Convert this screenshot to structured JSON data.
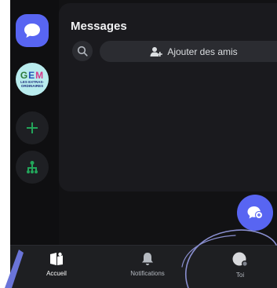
{
  "header": {
    "title": "Messages"
  },
  "search": {
    "icon": "search-icon"
  },
  "add_friends": {
    "label": "Ajouter des amis",
    "icon": "add-user-icon"
  },
  "rail": {
    "servers": [
      {
        "name": "GEM",
        "subtitle": "LES EXTRAS-ORDINAIRES"
      }
    ]
  },
  "bottom_nav": {
    "items": [
      {
        "label": "Accueil",
        "icon": "home-server-icon",
        "active": true
      },
      {
        "label": "Notifications",
        "icon": "bell-icon",
        "active": false
      },
      {
        "label": "Toi",
        "icon": "avatar-icon",
        "active": false
      }
    ]
  },
  "colors": {
    "accent": "#5865f2",
    "background": "#121214",
    "panel": "#1a1a1e",
    "green": "#23a55a"
  }
}
